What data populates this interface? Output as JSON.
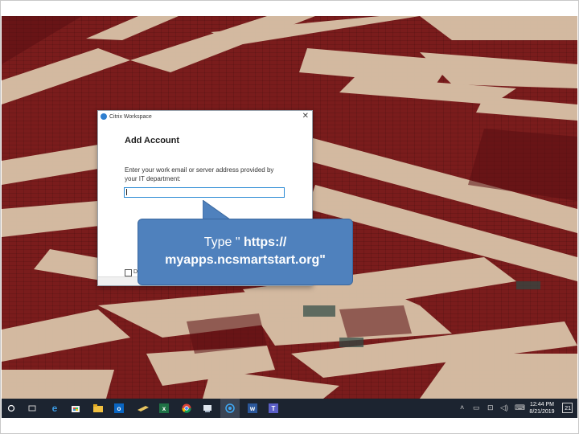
{
  "dialog": {
    "app_title": "Citrix Workspace",
    "heading": "Add Account",
    "prompt": "Enter your work email or server address provided by your IT department:",
    "input_value": "",
    "checkbox_label": "D"
  },
  "callout": {
    "prefix": "Type \" ",
    "url_part1": "https://",
    "url_part2": "myapps.ncsmartstart.org\""
  },
  "taskbar": {
    "icons": [
      "windows-start-icon",
      "task-view-icon",
      "edge-icon",
      "store-icon",
      "file-explorer-icon",
      "outlook-icon",
      "notes-icon",
      "excel-icon",
      "chrome-icon",
      "network-app-icon",
      "citrix-workspace-icon",
      "word-icon",
      "teams-icon"
    ],
    "clock_time": "12:44 PM",
    "clock_date": "8/21/2019",
    "notification_count": "21"
  },
  "colors": {
    "callout_fill": "#4f81bd",
    "taskbar": "#1c2430",
    "input_border": "#2a8ad4"
  }
}
